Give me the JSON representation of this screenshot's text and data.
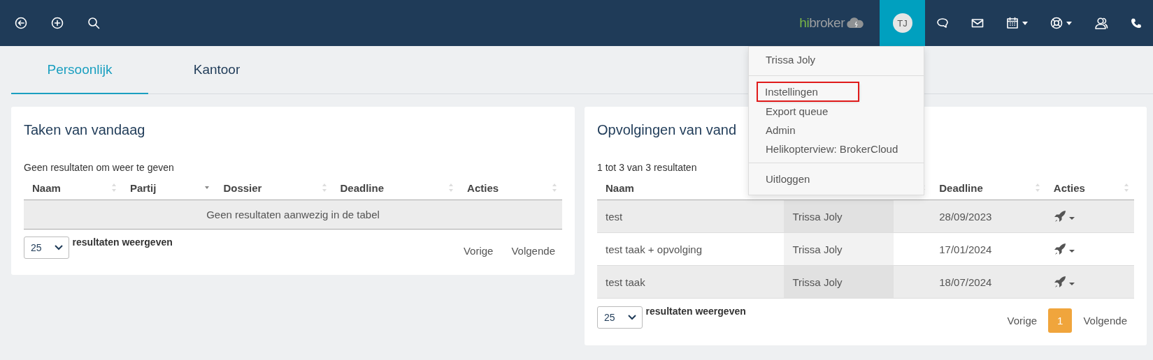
{
  "topbar": {
    "logo": {
      "part_1": "hi",
      "part_2": "broker"
    },
    "user": {
      "initials": "TJ",
      "selected": true
    },
    "icons": [
      {
        "kind": "chat",
        "caret": false
      },
      {
        "kind": "mail",
        "caret": false
      },
      {
        "kind": "calendar",
        "caret": true
      },
      {
        "kind": "lifebuoy",
        "caret": true
      },
      {
        "kind": "users",
        "caret": false
      },
      {
        "kind": "phone",
        "caret": false
      }
    ]
  },
  "tabs": [
    {
      "label": "Persoonlijk",
      "selected": true
    },
    {
      "label": "Kantoor",
      "selected": false
    }
  ],
  "cards": [
    {
      "title": "Taken van vandaag",
      "info": "Geen resultaten om weer te geven",
      "columns": [
        {
          "label": "Naam",
          "sortable": true,
          "sorted": false
        },
        {
          "label": "Partij",
          "sortable": true,
          "sorted": true
        },
        {
          "label": "Dossier",
          "sortable": true,
          "sorted": false
        },
        {
          "label": "Deadline",
          "sortable": true,
          "sorted": false
        },
        {
          "label": "Acties",
          "sortable": true,
          "sorted": false
        }
      ],
      "empty_message": "Geen resultaten aanwezig in de tabel",
      "page_size": "25",
      "page_size_label": "resultaten weergeven",
      "prev": "Vorige",
      "next": "Volgende"
    },
    {
      "title": "Opvolgingen van vand",
      "info": "1 tot 3 van 3 resultaten",
      "columns": [
        {
          "label": "Naam",
          "sortable": false,
          "sorted": false
        },
        {
          "sortable": false,
          "sorted": true
        },
        {
          "sortable": true,
          "sorted": false
        },
        {
          "label": "Deadline",
          "sortable": true,
          "sorted": false
        },
        {
          "label": "Acties",
          "sortable": true,
          "sorted": false
        }
      ],
      "rows": [
        {
          "cells": [
            "test",
            "Trissa Joly",
            null,
            "28/09/2023"
          ]
        },
        {
          "cells": [
            "test taak + opvolging",
            "Trissa Joly",
            null,
            "17/01/2024"
          ]
        },
        {
          "cells": [
            "test taak",
            "Trissa Joly",
            null,
            "18/07/2024"
          ]
        }
      ],
      "page_size": "25",
      "page_size_label": "resultaten weergeven",
      "prev": "Vorige",
      "next": "Volgende",
      "pages": [
        {
          "label": "1",
          "selected": true
        }
      ]
    }
  ],
  "user_menu": {
    "sections": [
      [
        {
          "label": "Trissa Joly",
          "highlighted": false
        }
      ],
      [
        {
          "label": "Instellingen",
          "highlighted": true
        },
        {
          "label": "Export queue",
          "highlighted": false
        },
        {
          "label": "Admin",
          "highlighted": false
        },
        {
          "label": "Helikopterview: BrokerCloud",
          "highlighted": false
        }
      ],
      [
        {
          "label": "Uitloggen",
          "highlighted": false
        }
      ]
    ]
  }
}
